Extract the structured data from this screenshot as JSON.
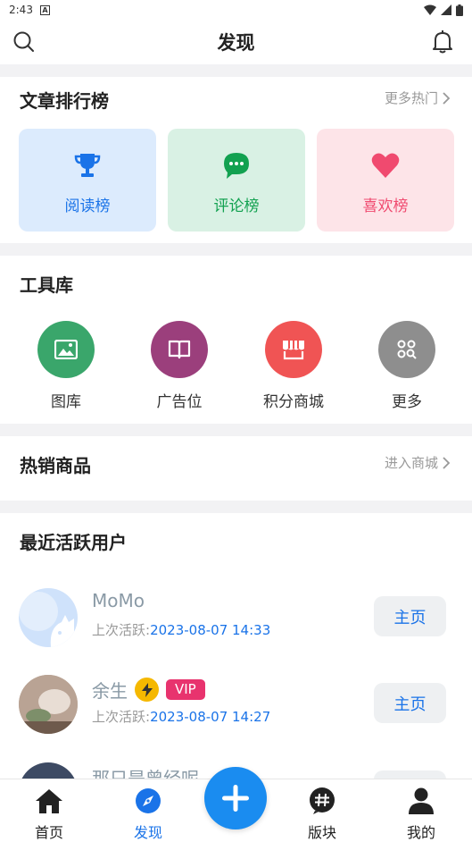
{
  "status": {
    "time": "2:43",
    "notif_letter": "A"
  },
  "header": {
    "title": "发现"
  },
  "ranking": {
    "title": "文章排行榜",
    "more": "更多热门",
    "tiles": [
      {
        "label": "阅读榜",
        "icon": "trophy-icon",
        "bg": "#dcebfd",
        "color": "#1a73e8"
      },
      {
        "label": "评论榜",
        "icon": "chat-bubble-icon",
        "bg": "#d9f1e4",
        "color": "#12a150"
      },
      {
        "label": "喜欢榜",
        "icon": "heart-icon",
        "bg": "#fde4e8",
        "color": "#f04a6f"
      }
    ]
  },
  "tools": {
    "title": "工具库",
    "items": [
      {
        "label": "图库",
        "icon": "image-icon",
        "color": "#3aa66b"
      },
      {
        "label": "广告位",
        "icon": "book-icon",
        "color": "#9b3f7c"
      },
      {
        "label": "积分商城",
        "icon": "store-icon",
        "color": "#f05454"
      },
      {
        "label": "更多",
        "icon": "grid-search-icon",
        "color": "#8e8e8e"
      }
    ]
  },
  "hot": {
    "title": "热销商品",
    "more": "进入商城"
  },
  "users": {
    "title": "最近活跃用户",
    "active_prefix": "上次活跃:",
    "button_label": "主页",
    "list": [
      {
        "name": "MoMo",
        "time": "2023-08-07 14:33",
        "vip": ""
      },
      {
        "name": "余生",
        "time": "2023-08-07 14:27",
        "vip": "VIP"
      },
      {
        "name": "那只是曾经呢",
        "time": "",
        "vip": ""
      }
    ]
  },
  "bottom_nav": {
    "items": [
      {
        "label": "首页",
        "icon": "home-icon"
      },
      {
        "label": "发现",
        "icon": "compass-icon"
      },
      {
        "label": "版块",
        "icon": "hashtag-icon"
      },
      {
        "label": "我的",
        "icon": "person-icon"
      }
    ],
    "fab_icon": "plus-icon"
  },
  "colors": {
    "accent": "#1a73e8",
    "fab": "#1a8cf0"
  }
}
